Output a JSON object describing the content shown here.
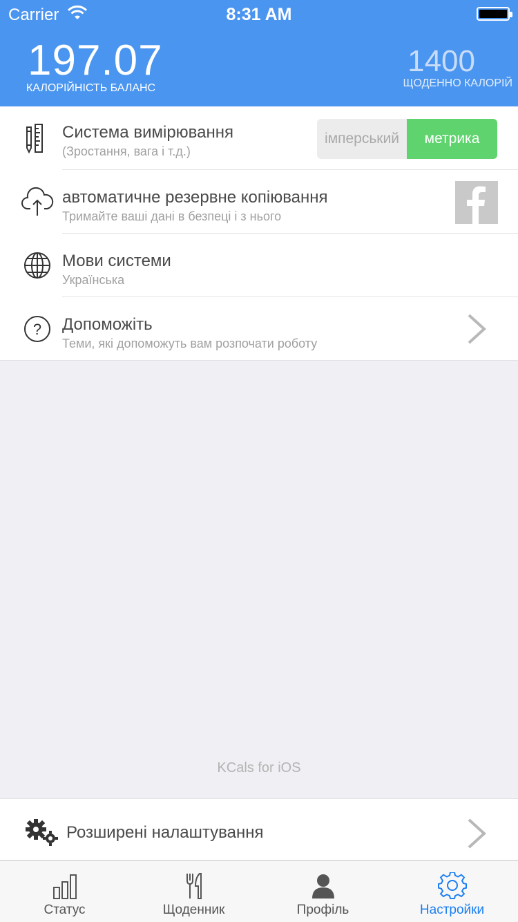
{
  "status_bar": {
    "carrier": "Carrier",
    "time": "8:31 AM"
  },
  "header": {
    "balance_value": "197.07",
    "balance_label": "КАЛОРІЙНІСТЬ БАЛАНС",
    "daily_value": "1400",
    "daily_label": "ЩОДЕННО КАЛОРІЙ",
    "color": "#4a95ef"
  },
  "settings": {
    "items": [
      {
        "title": "Система вимірювання",
        "subtitle": "(Зростання, вага і т.д.)",
        "icon": "ruler-pencil-icon",
        "segment": {
          "options": [
            "імперський",
            "метрика"
          ],
          "selected": "метрика"
        }
      },
      {
        "title": "автоматичне резервне копіювання",
        "subtitle": "Тримайте ваші дані в безпеці і з нього",
        "icon": "cloud-upload-icon",
        "action_icon": "facebook-icon"
      },
      {
        "title": "Мови системи",
        "subtitle": "Українська",
        "icon": "globe-icon"
      },
      {
        "title": "Допоможіть",
        "subtitle": "Теми, які допоможуть вам розпочати роботу",
        "icon": "help-icon"
      }
    ]
  },
  "footer_text": "KCals for iOS",
  "advanced": {
    "label": "Розширені налаштування",
    "icon": "gears-icon"
  },
  "tabs": [
    {
      "label": "Статус",
      "icon": "bar-chart-icon"
    },
    {
      "label": "Щоденник",
      "icon": "fork-knife-icon"
    },
    {
      "label": "Профіль",
      "icon": "person-icon"
    },
    {
      "label": "Настройки",
      "icon": "gear-icon",
      "active": true
    }
  ],
  "colors": {
    "accent": "#1a7ef2",
    "switch_on": "#5fd46e",
    "background": "#efeff4"
  }
}
